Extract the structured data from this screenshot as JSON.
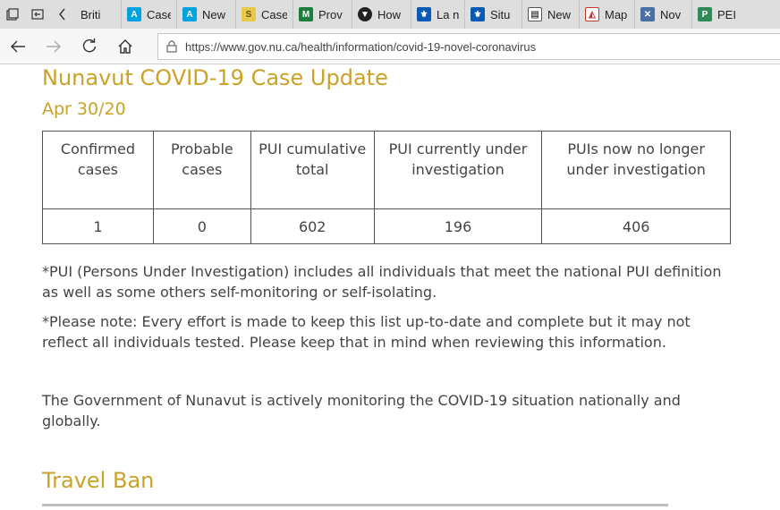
{
  "browser": {
    "tabs": [
      {
        "label": "Briti",
        "icon": "page-icon",
        "color": "#ffffff"
      },
      {
        "label": "Case",
        "icon": "alberta-icon",
        "color": "#00a3e0"
      },
      {
        "label": "New",
        "icon": "alberta-icon",
        "color": "#00a3e0"
      },
      {
        "label": "Case",
        "icon": "saskatchewan-icon",
        "color": "#e8c84a"
      },
      {
        "label": "Prov",
        "icon": "manitoba-icon",
        "color": "#1a7f3c"
      },
      {
        "label": "How",
        "icon": "ontario-icon",
        "color": "#222222"
      },
      {
        "label": "La n",
        "icon": "quebec-icon",
        "color": "#0a5ab4"
      },
      {
        "label": "Situ",
        "icon": "quebec-icon",
        "color": "#0a5ab4"
      },
      {
        "label": "New",
        "icon": "nb-icon",
        "color": "#555555"
      },
      {
        "label": "Map",
        "icon": "ns-icon",
        "color": "#c0392b"
      },
      {
        "label": "Nov",
        "icon": "nl-icon",
        "color": "#4a6fa5"
      },
      {
        "label": "PEI (",
        "icon": "pei-icon",
        "color": "#2e8b57"
      }
    ],
    "url": "https://www.gov.nu.ca/health/information/covid-19-novel-coronavirus"
  },
  "page": {
    "title": "Nunavut COVID-19 Case Update",
    "date": "Apr 30/20",
    "table": {
      "headers": [
        "Confirmed cases",
        "Probable cases",
        "PUI cumulative total",
        "PUI currently under investigation",
        "PUIs now no longer under investigation"
      ],
      "row": [
        "1",
        "0",
        "602",
        "196",
        "406"
      ]
    },
    "note_pui": "*PUI (Persons Under Investigation) includes all individuals that meet the national PUI definition as well as some others self-monitoring or self-isolating.",
    "note_please": "*Please note: Every effort is made to keep this list up-to-date and complete but it may not reflect all individuals tested. Please keep that in mind when reviewing this information.",
    "monitoring": "The Government of Nunavut is actively monitoring the COVID-19 situation nationally and globally.",
    "travel_heading": "Travel Ban"
  },
  "colors": {
    "heading_gold": "#c9a227",
    "tab_strip": "#dedede",
    "body_text": "#444444"
  }
}
